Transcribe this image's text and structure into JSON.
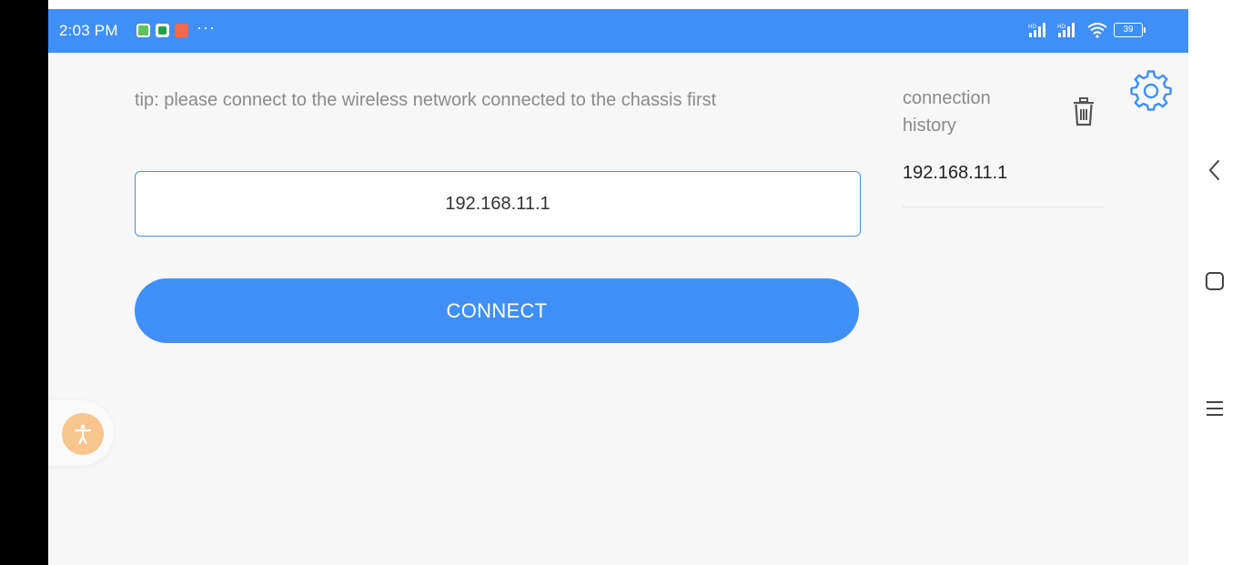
{
  "status_bar": {
    "time": "2:03 PM",
    "dots": "···",
    "battery": "39",
    "background_color": "#3f8ff6",
    "icons": [
      "app-notification-icon",
      "app-notification-icon",
      "app-notification-icon",
      "signal-hd-icon",
      "signal-hd-icon",
      "wifi-icon",
      "battery-icon"
    ]
  },
  "main": {
    "tip": "tip: please connect to the wireless network connected to the chassis first",
    "ip_input_value": "192.168.11.1",
    "connect_label": "CONNECT",
    "accent_color": "#3f8ff6"
  },
  "history": {
    "title": "connection history",
    "items": [
      "192.168.11.1"
    ],
    "icons": [
      "trash-icon",
      "gear-icon"
    ]
  },
  "floating": {
    "icon": "accessibility-icon",
    "color": "#f8c58f"
  },
  "nav": {
    "icons": [
      "back-icon",
      "home-icon",
      "menu-icon"
    ]
  }
}
